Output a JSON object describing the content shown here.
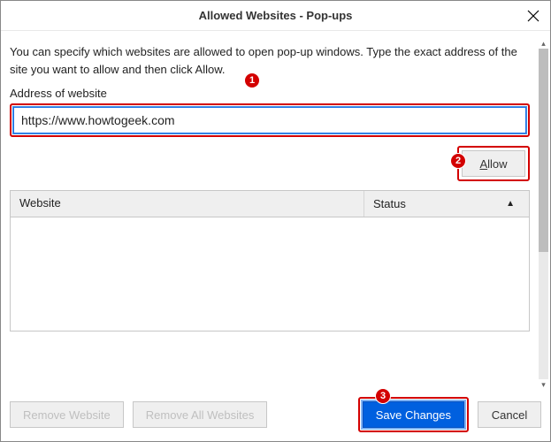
{
  "title": "Allowed Websites - Pop-ups",
  "intro": "You can specify which websites are allowed to open pop-up windows. Type the exact address of the site you want to allow and then click Allow.",
  "address_label": "Address of website",
  "address_value": "https://www.howtogeek.com",
  "allow_label": "Allow",
  "table": {
    "col_website": "Website",
    "col_status": "Status",
    "sort_indicator": "▲"
  },
  "buttons": {
    "remove_one": "Remove Website",
    "remove_all": "Remove All Websites",
    "save": "Save Changes",
    "cancel": "Cancel"
  },
  "annotations": {
    "b1": "1",
    "b2": "2",
    "b3": "3"
  }
}
